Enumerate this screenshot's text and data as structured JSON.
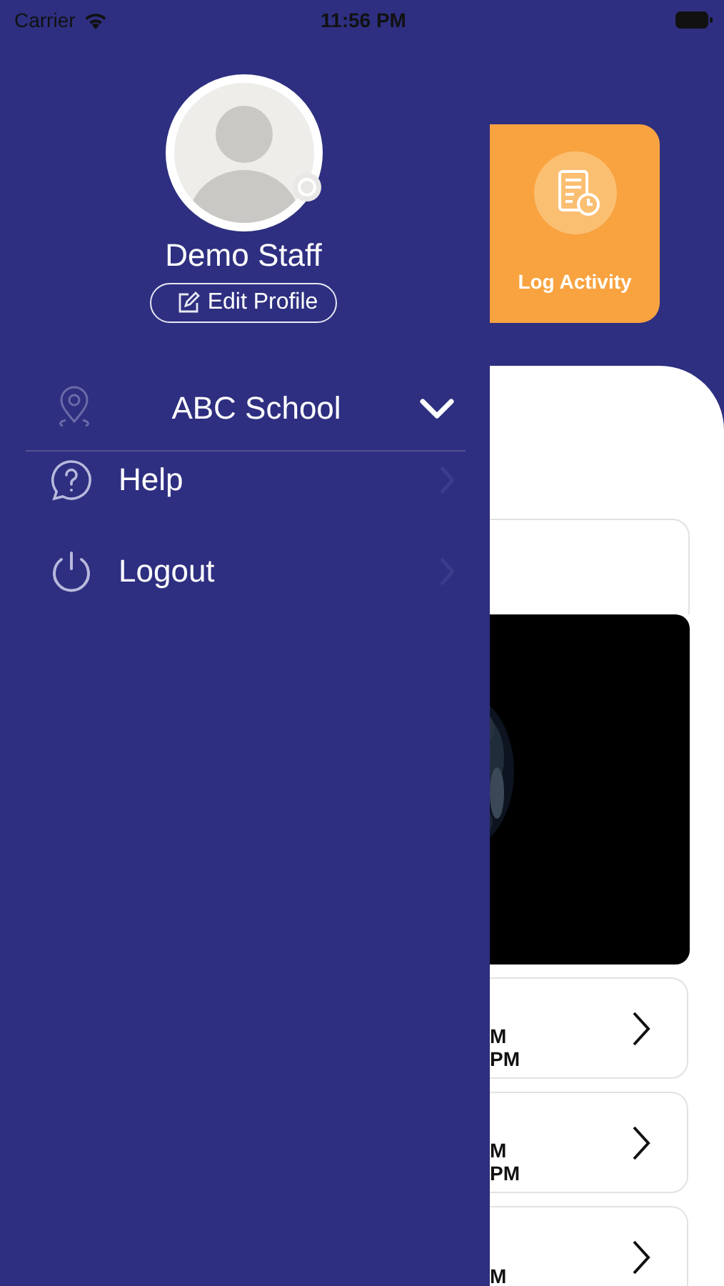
{
  "status_bar": {
    "carrier": "Carrier",
    "time": "11:56 PM"
  },
  "drawer": {
    "profile": {
      "name": "Demo Staff",
      "edit_button": "Edit Profile"
    },
    "school": {
      "name": "ABC School",
      "expanded": false
    },
    "menu": [
      {
        "kind": "help",
        "label": "Help"
      },
      {
        "kind": "logout",
        "label": "Logout"
      }
    ]
  },
  "background": {
    "action_card": {
      "label": "Log Activity"
    },
    "list_rows": [
      {
        "line_1": "M",
        "line_2": "PM"
      },
      {
        "line_1": "M",
        "line_2": "PM"
      },
      {
        "line_1": "M"
      }
    ]
  }
}
